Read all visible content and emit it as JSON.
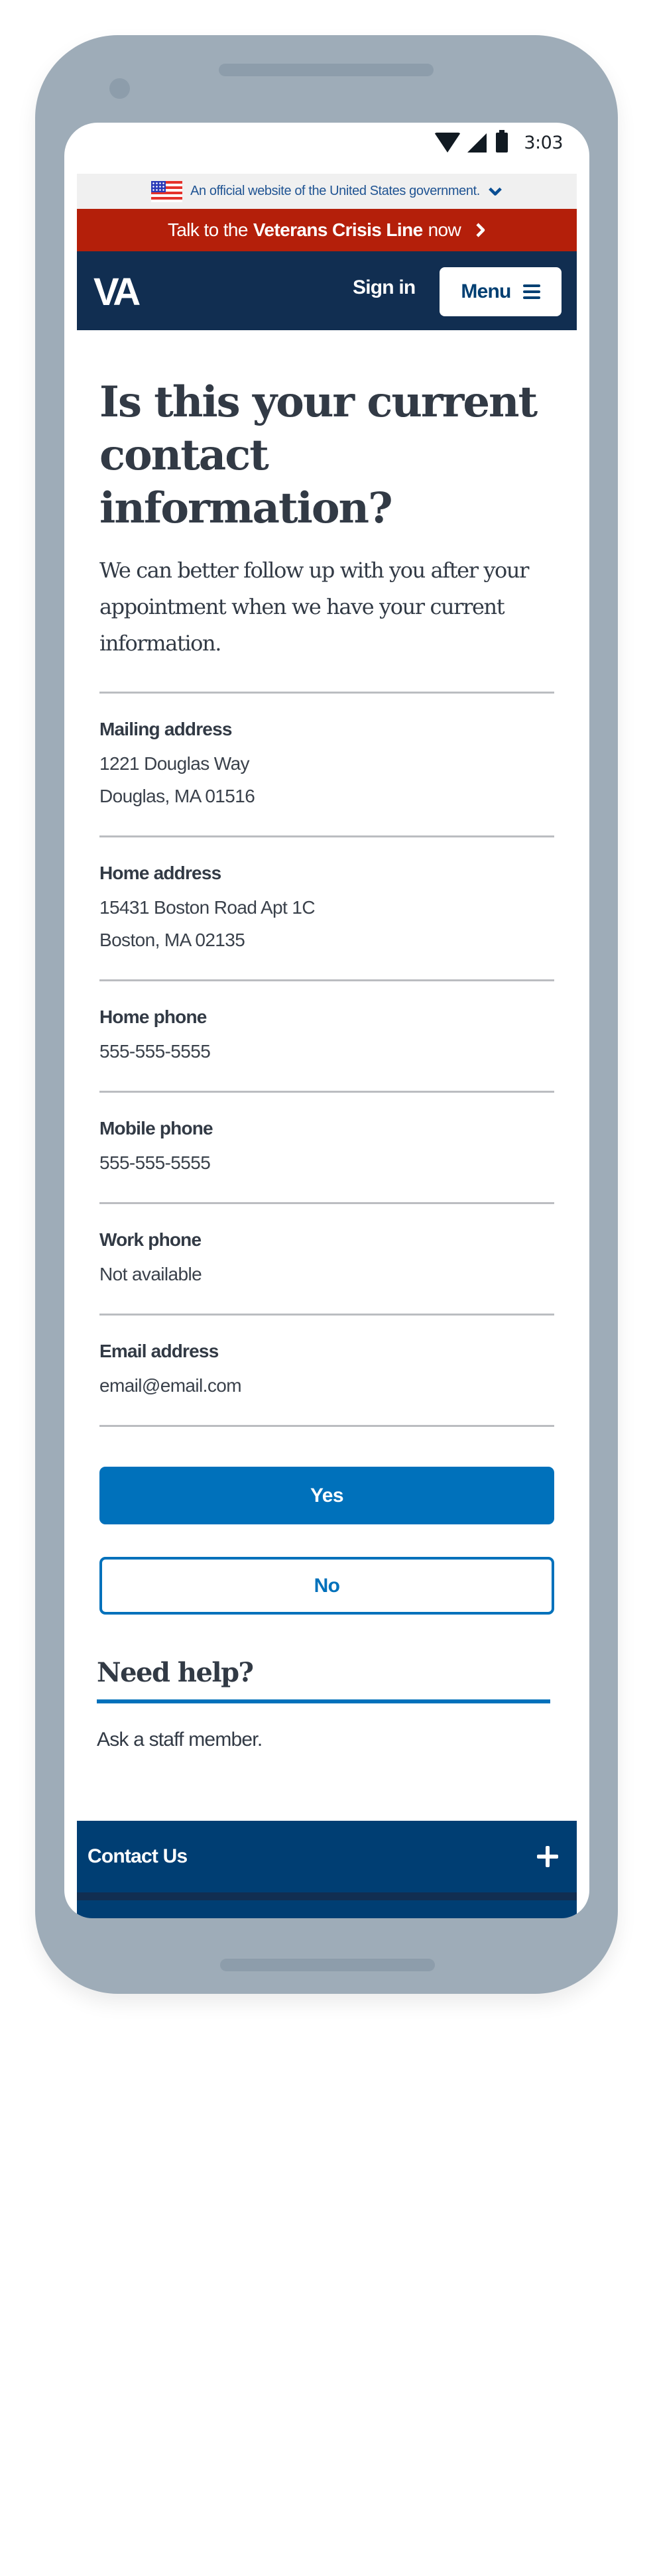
{
  "status_bar": {
    "time": "3:03",
    "icons": [
      "wifi-icon",
      "signal-icon",
      "battery-icon"
    ]
  },
  "gov_banner": {
    "text": "An official website of the United States government.",
    "icon": "us-flag-icon",
    "expand_icon": "chevron-down-icon"
  },
  "crisis_line": {
    "prefix": "Talk to the",
    "bold": "Veterans Crisis Line",
    "suffix": "now",
    "icon": "chevron-right-icon"
  },
  "header": {
    "logo": "VA",
    "sign_in_label": "Sign in",
    "menu_label": "Menu"
  },
  "main": {
    "title": "Is this your current contact information?",
    "intro": "We can better follow up with you after your appointment when we have your current information.",
    "contact_items": [
      {
        "label": "Mailing address",
        "lines": [
          "1221 Douglas Way",
          "Douglas, MA 01516"
        ]
      },
      {
        "label": "Home address",
        "lines": [
          "15431 Boston Road Apt 1C",
          "Boston, MA 02135"
        ]
      },
      {
        "label": "Home phone",
        "lines": [
          "555-555-5555"
        ]
      },
      {
        "label": "Mobile phone",
        "lines": [
          "555-555-5555"
        ]
      },
      {
        "label": "Work phone",
        "lines": [
          "Not available"
        ]
      },
      {
        "label": "Email address",
        "lines": [
          "email@email.com"
        ]
      }
    ],
    "yes_label": "Yes",
    "no_label": "No"
  },
  "help": {
    "title": "Need help?",
    "text": "Ask a staff member."
  },
  "footer": {
    "contact_label": "Contact Us",
    "expand_icon": "plus-icon"
  },
  "colors": {
    "primary": "#0071bb",
    "header_navy": "#112e51",
    "crisis_red": "#b41f0a",
    "footer_blue": "#003e73",
    "device_frame": "#9eacb8"
  }
}
